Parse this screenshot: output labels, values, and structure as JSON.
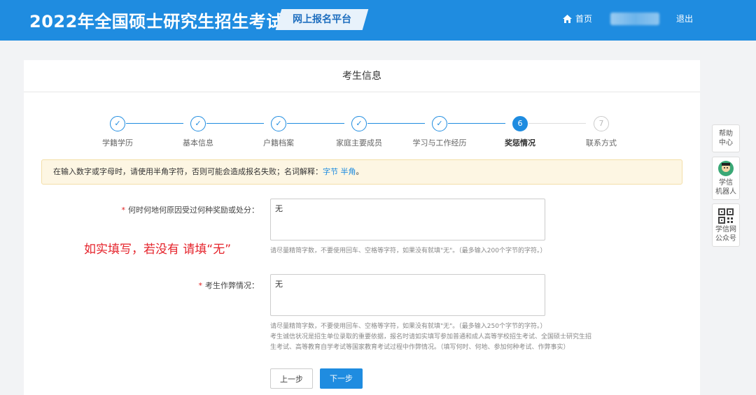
{
  "header": {
    "title": "2022年全国硕士研究生招生考试",
    "platform": "网上报名平台",
    "home": "首页",
    "logout": "退出"
  },
  "card": {
    "title": "考生信息"
  },
  "steps": [
    {
      "num": "✓",
      "label": "学籍学历",
      "state": "done"
    },
    {
      "num": "✓",
      "label": "基本信息",
      "state": "done"
    },
    {
      "num": "✓",
      "label": "户籍档案",
      "state": "done"
    },
    {
      "num": "✓",
      "label": "家庭主要成员",
      "state": "done"
    },
    {
      "num": "✓",
      "label": "学习与工作经历",
      "state": "done"
    },
    {
      "num": "6",
      "label": "奖惩情况",
      "state": "active"
    },
    {
      "num": "7",
      "label": "联系方式",
      "state": "pending"
    }
  ],
  "notice": {
    "text": "在输入数字或字母时，请使用半角字符，否则可能会造成报名失败；名词解释：",
    "link_bytes": "字节",
    "link_halfwidth": "半角",
    "end": "。"
  },
  "form": {
    "required_mark": "*",
    "reward": {
      "label": "何时何地何原因受过何种奖励或处分：",
      "value": "无",
      "hint": "请尽量精简字数，不要使用回车、空格等字符，如果没有就填\"无\"。（最多输入200个字节的字符。）"
    },
    "cheating": {
      "label": "考生作弊情况：",
      "value": "无",
      "hint1": "请尽量精简字数，不要使用回车、空格等字符，如果没有就填\"无\"。（最多输入250个字节的字符。）",
      "hint2": "考生诚信状况是招生单位录取的重要依据，报名时请如实填写参加普通和成人高等学校招生考试、全国硕士研究生招",
      "hint3": "生考试、高等教育自学考试等国家教育考试过程中作弊情况。（填写何时、何地、参加何种考试、作弊事实）"
    }
  },
  "annotation": "如实填写，若没有 请填“无”",
  "buttons": {
    "prev": "上一步",
    "next": "下一步"
  },
  "sidebar": {
    "help_line1": "帮助",
    "help_line2": "中心",
    "robot_line1": "学信",
    "robot_line2": "机器人",
    "qr_line1": "学信网",
    "qr_line2": "公众号"
  },
  "colors": {
    "primary": "#1f8ce0",
    "required": "#e02020",
    "annotation": "#e5232b",
    "notice_bg": "#fdf6e3"
  }
}
